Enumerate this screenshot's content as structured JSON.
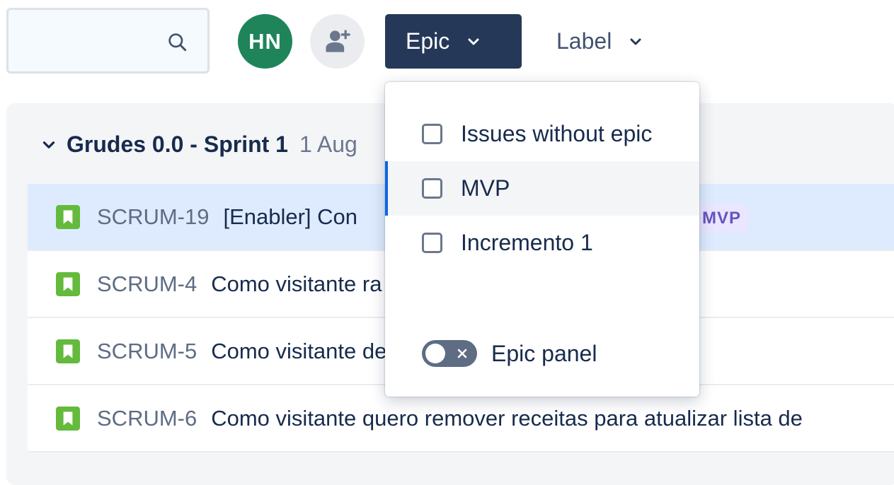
{
  "toolbar": {
    "search": {
      "placeholder": ""
    },
    "avatar_initials": "HN",
    "epic_filter_label": "Epic",
    "label_filter_label": "Label"
  },
  "colors": {
    "accent_dark": "#253858",
    "avatar_bg": "#1f845a",
    "story_green": "#63ba3c",
    "selected_row": "#deebff",
    "epic_lozenge_bg": "#eae6ff",
    "epic_lozenge_text": "#6554c0",
    "focus_blue": "#0c66e4"
  },
  "sprint": {
    "name": "Grudes 0.0 - Sprint 1",
    "dates": "1 Aug"
  },
  "issues": [
    {
      "key": "SCRUM-19",
      "summary": "[Enabler] Con",
      "epic": "MVP",
      "selected": true,
      "icon": "story-icon"
    },
    {
      "key": "SCRUM-4",
      "summary": "Como visitante ra ver em forma d",
      "icon": "story-icon"
    },
    {
      "key": "SCRUM-5",
      "summary": "Como visitante de ingredientes p",
      "icon": "story-icon"
    },
    {
      "key": "SCRUM-6",
      "summary": "Como visitante quero remover receitas para atualizar lista de",
      "icon": "story-icon"
    }
  ],
  "epic_dropdown": {
    "options": [
      {
        "label": "Issues without epic",
        "checked": false
      },
      {
        "label": "MVP",
        "checked": false,
        "hovered": true
      },
      {
        "label": "Incremento 1",
        "checked": false
      }
    ],
    "panel_toggle_label": "Epic panel",
    "panel_toggle_on": false
  }
}
